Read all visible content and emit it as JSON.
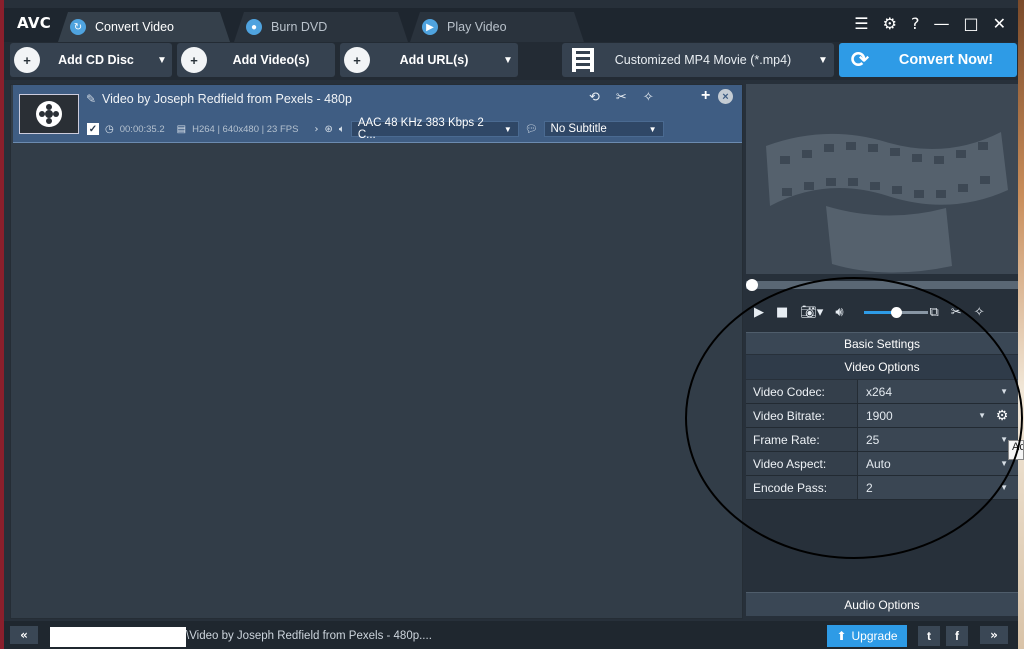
{
  "app": {
    "logo": "AVC"
  },
  "tabs": [
    {
      "label": "Convert Video",
      "icon": "refresh-icon"
    },
    {
      "label": "Burn DVD",
      "icon": "disc-icon"
    },
    {
      "label": "Play Video",
      "icon": "play-icon"
    }
  ],
  "window_controls": {
    "menu": "☰",
    "settings": "⚙",
    "help": "?",
    "minimize": "—",
    "maximize": "□",
    "close": "✕"
  },
  "toolbar": {
    "add_cd": "Add CD Disc",
    "add_video": "Add Video(s)",
    "add_url": "Add URL(s)",
    "profile": "Customized MP4 Movie (*.mp4)",
    "convert": "Convert Now!"
  },
  "file": {
    "title": "Video by Joseph Redfield from Pexels - 480p",
    "duration": "00:00:35.2",
    "video_info": "H264 | 640x480 | 23 FPS",
    "audio_track": "AAC 48 KHz 383 Kbps 2 C...",
    "subtitle": "No Subtitle"
  },
  "panel": {
    "basic_settings": "Basic Settings",
    "video_options": "Video Options",
    "audio_options": "Audio Options"
  },
  "settings": [
    {
      "label": "Video Codec:",
      "value": "x264"
    },
    {
      "label": "Video Bitrate:",
      "value": "1900"
    },
    {
      "label": "Frame Rate:",
      "value": "25"
    },
    {
      "label": "Video Aspect:",
      "value": "Auto"
    },
    {
      "label": "Encode Pass:",
      "value": "2"
    }
  ],
  "tooltip": "Ac",
  "status": {
    "path": "\\Video by Joseph Redfield from Pexels - 480p....",
    "upgrade": "Upgrade",
    "collapse": "«",
    "expand": "»"
  },
  "colors": {
    "accent": "#2e9be6",
    "selected_row": "#3f5d83",
    "frame": "#8a1f2c"
  }
}
